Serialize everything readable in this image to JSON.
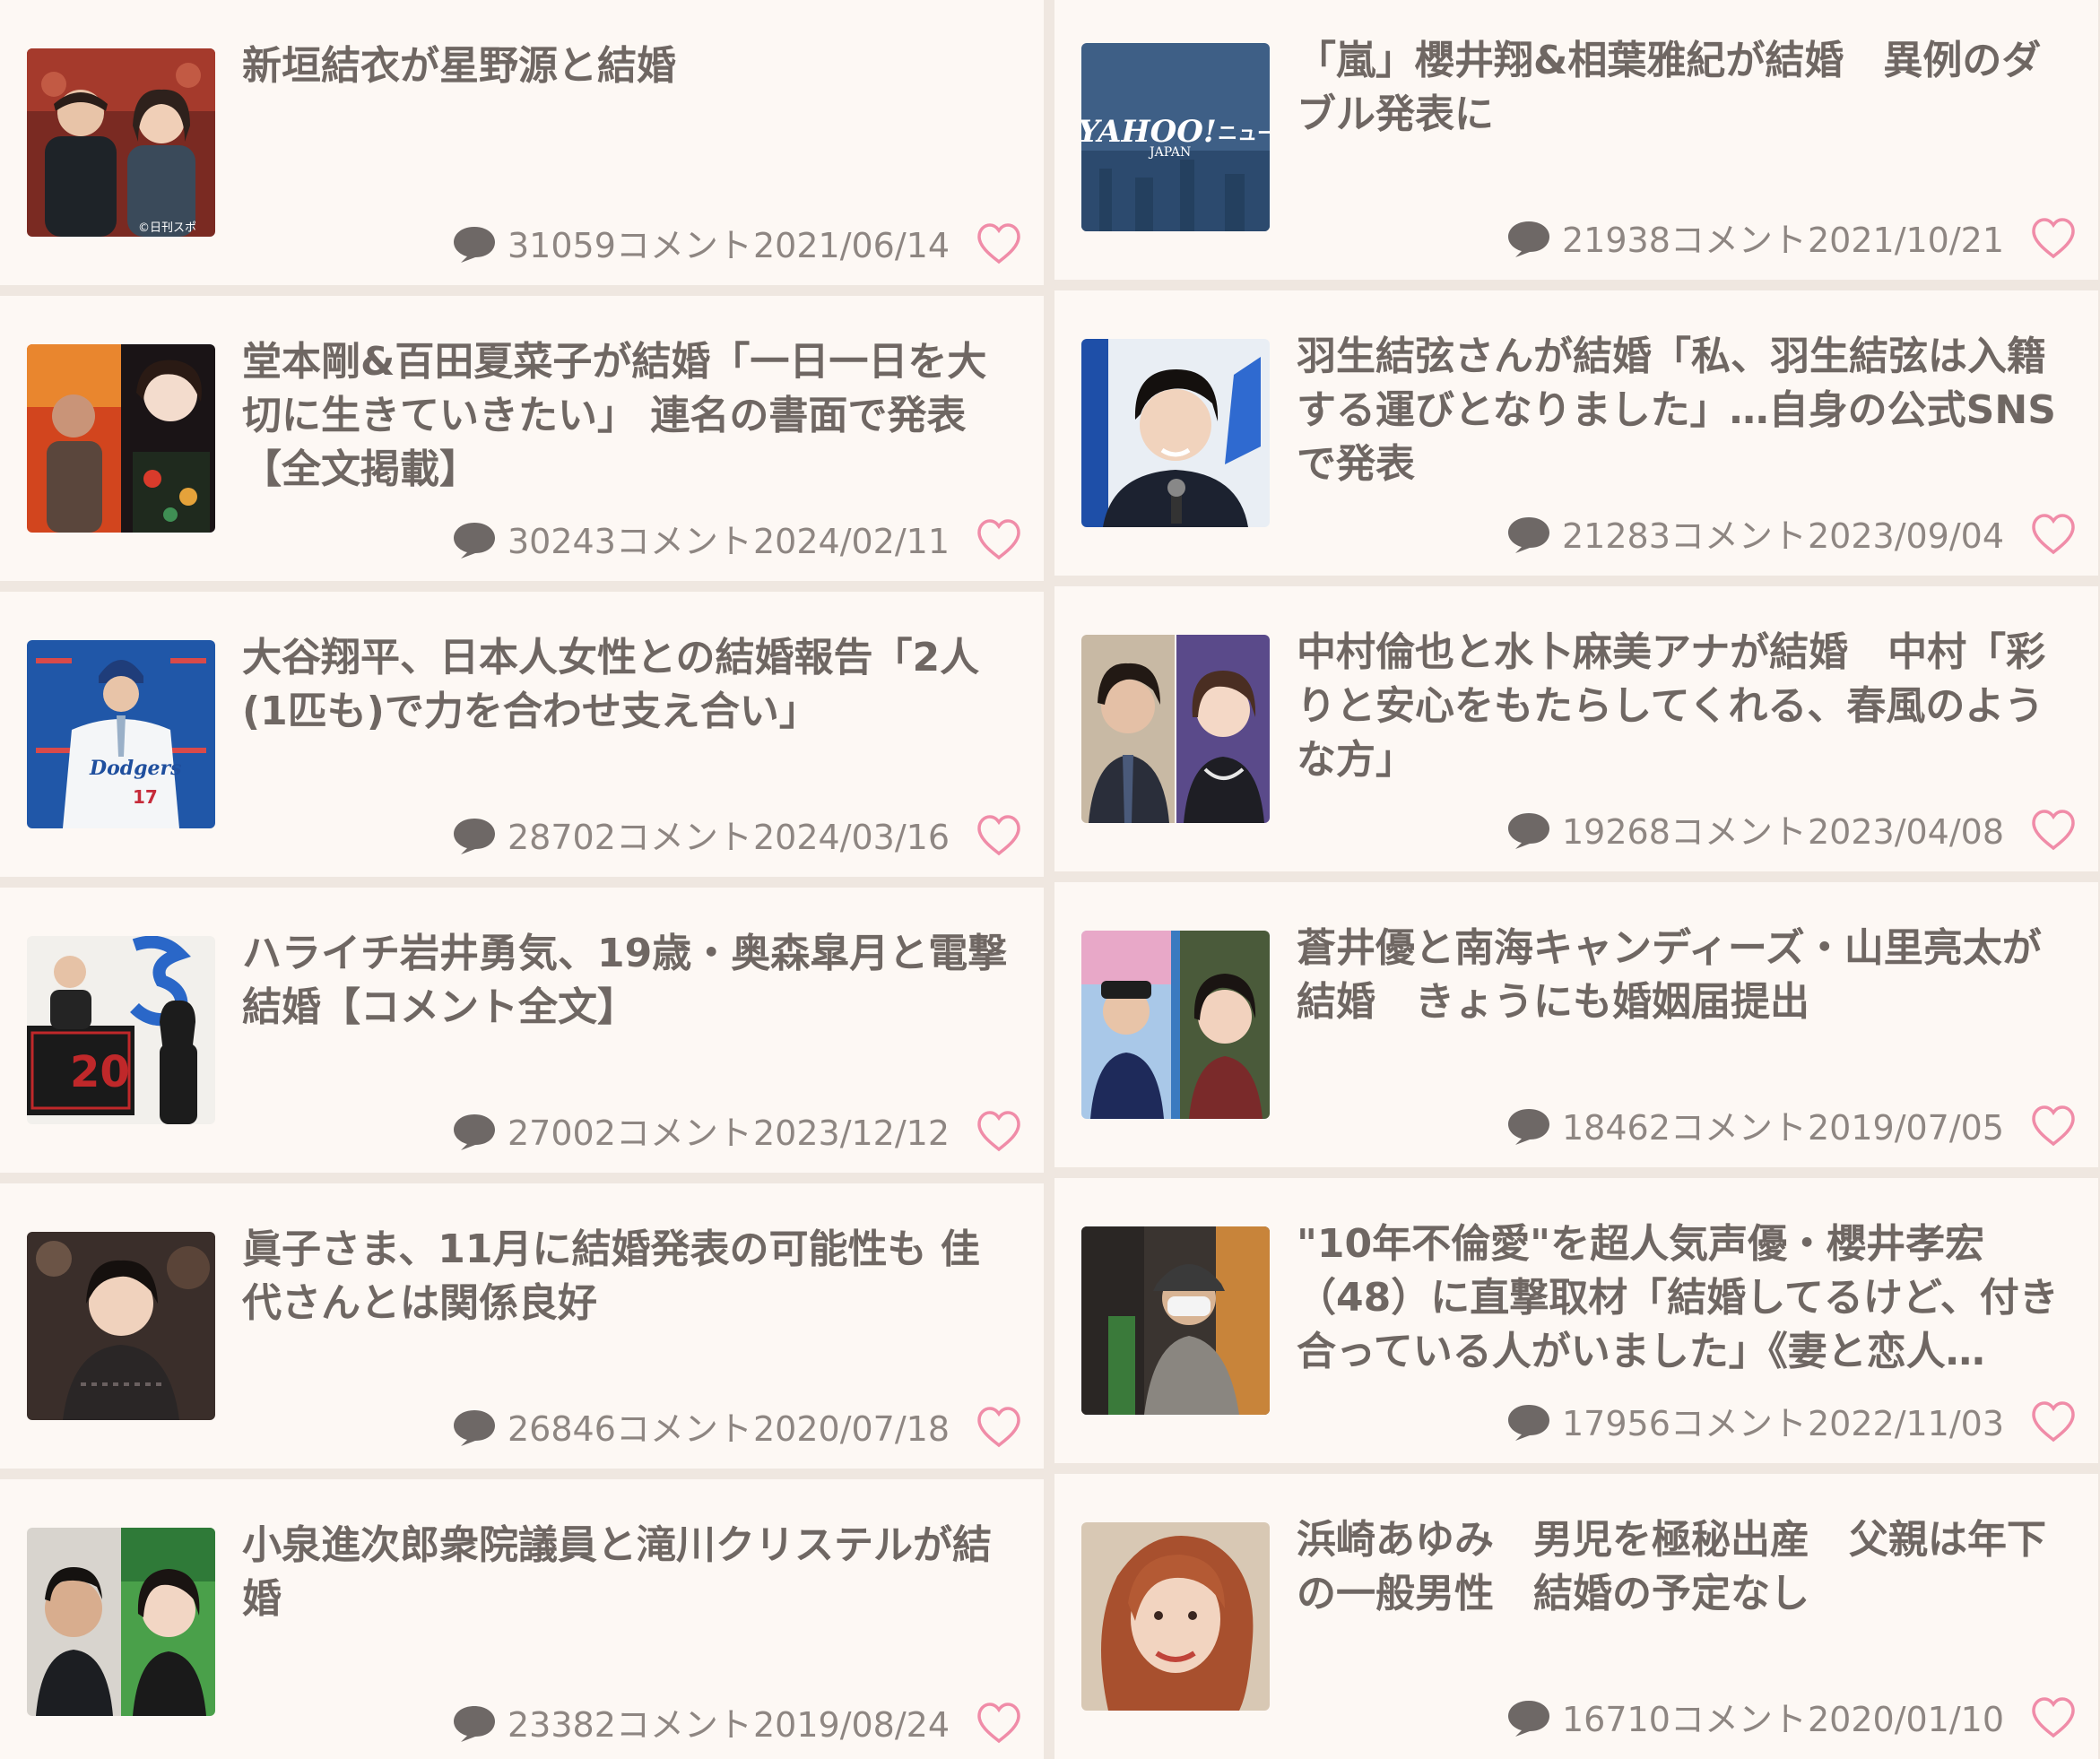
{
  "left_column": [
    {
      "title": "新垣結衣が星野源と結婚",
      "comments": "31059コメント",
      "date": "2021/06/14",
      "thumb_caption": "©日刊スポ"
    },
    {
      "title": "堂本剛&百田夏菜子が結婚「一日一日を大切に生きていきたい」 連名の書面で発表【全文掲載】",
      "comments": "30243コメント",
      "date": "2024/02/11"
    },
    {
      "title": "大谷翔平、日本人女性との結婚報告「2人(1匹も)で力を合わせ支え合い」",
      "comments": "28702コメント",
      "date": "2024/03/16",
      "thumb_text": "Dodgers",
      "thumb_number": "17"
    },
    {
      "title": "ハライチ岩井勇気、19歳・奥森皐月と電撃結婚【コメント全文】",
      "comments": "27002コメント",
      "date": "2023/12/12",
      "thumb_text": "20"
    },
    {
      "title": "眞子さま、11月に結婚発表の可能性も 佳代さんとは関係良好",
      "comments": "26846コメント",
      "date": "2020/07/18"
    },
    {
      "title": "小泉進次郎衆院議員と滝川クリステルが結婚",
      "comments": "23382コメント",
      "date": "2019/08/24"
    }
  ],
  "right_column": [
    {
      "title": "「嵐」櫻井翔&相葉雅紀が結婚　異例のダブル発表に",
      "comments": "21938コメント",
      "date": "2021/10/21",
      "thumb_logo": "YAHOO!",
      "thumb_logo_sub": "JAPAN",
      "thumb_logo_suffix": "ニュー"
    },
    {
      "title": "羽生結弦さんが結婚「私、羽生結弦は入籍する運びとなりました」…自身の公式SNSで発表",
      "comments": "21283コメント",
      "date": "2023/09/04"
    },
    {
      "title": "中村倫也と水卜麻美アナが結婚　中村「彩りと安心をもたらしてくれる、春風のような方」",
      "comments": "19268コメント",
      "date": "2023/04/08"
    },
    {
      "title": "蒼井優と南海キャンディーズ・山里亮太が結婚　きょうにも婚姻届提出",
      "comments": "18462コメント",
      "date": "2019/07/05"
    },
    {
      "title": "\"10年不倫愛\"を超人気声優・櫻井孝宏（48）に直撃取材「結婚してるけど、付き合っている人がいました」《妻と恋人…",
      "comments": "17956コメント",
      "date": "2022/11/03"
    },
    {
      "title": "浜崎あゆみ　男児を極秘出産　父親は年下の一般男性　結婚の予定なし",
      "comments": "16710コメント",
      "date": "2020/01/10"
    }
  ],
  "colors": {
    "background": "#fdf8f4",
    "divider": "#efe7e0",
    "text": "#6f6763",
    "meta_text": "#8e8682",
    "icon_gray": "#6e6866",
    "heart": "#f08ca8"
  }
}
